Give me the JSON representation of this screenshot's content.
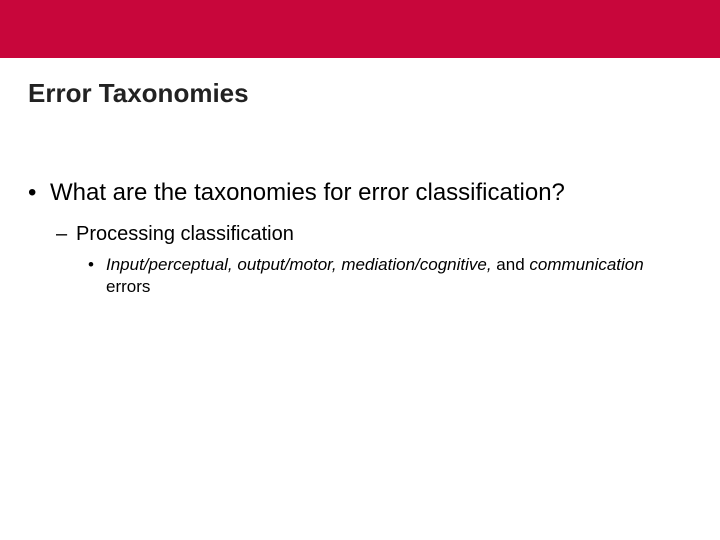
{
  "colors": {
    "brand_red": "#c8063b"
  },
  "slide": {
    "title": "Error Taxonomies",
    "level1": "What are the taxonomies for error classification?",
    "level2": "Processing classification",
    "level3_italic": "Input/perceptual, output/motor, mediation/cognitive,",
    "level3_rest1": " and ",
    "level3_italic2": "communication",
    "level3_rest2": " errors"
  }
}
